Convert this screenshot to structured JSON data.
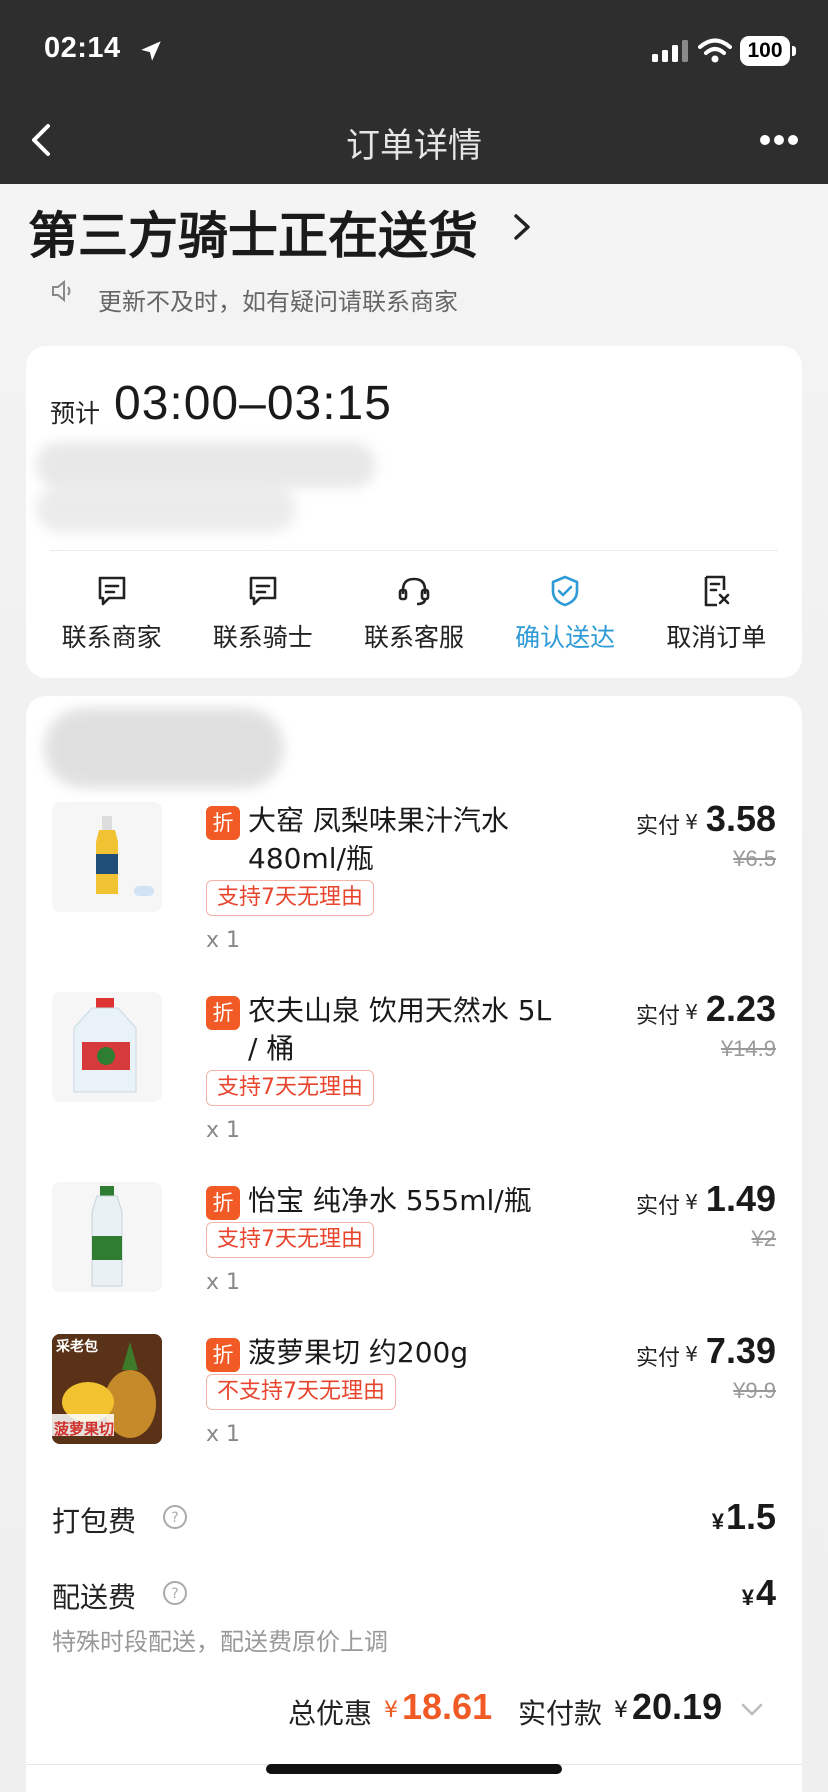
{
  "status_bar": {
    "time": "02:14",
    "battery": "100"
  },
  "nav": {
    "title": "订单详情"
  },
  "delivery": {
    "headline": "第三方骑士正在送货",
    "notice": "更新不及时，如有疑问请联系商家"
  },
  "eta": {
    "label": "预计",
    "time": "03:00–03:15"
  },
  "actions": [
    {
      "label": "联系商家",
      "icon": "chat-icon"
    },
    {
      "label": "联系骑士",
      "icon": "chat-icon"
    },
    {
      "label": "联系客服",
      "icon": "headset-icon"
    },
    {
      "label": "确认送达",
      "icon": "check-circle-icon",
      "active": true
    },
    {
      "label": "取消订单",
      "icon": "cancel-doc-icon"
    }
  ],
  "items": [
    {
      "badge": "折",
      "name": "大窑 凤梨味果汁汽水 480ml/瓶",
      "tag": "支持7天无理由",
      "qty": "x 1",
      "pay_label": "实付",
      "currency": "¥",
      "price": "3.58",
      "original": "¥6.5"
    },
    {
      "badge": "折",
      "name": "农夫山泉 饮用天然水 5L / 桶",
      "tag": "支持7天无理由",
      "qty": "x 1",
      "pay_label": "实付",
      "currency": "¥",
      "price": "2.23",
      "original": "¥14.9"
    },
    {
      "badge": "折",
      "name": "怡宝 纯净水 555ml/瓶",
      "tag": "支持7天无理由",
      "qty": "x 1",
      "pay_label": "实付",
      "currency": "¥",
      "price": "1.49",
      "original": "¥2"
    },
    {
      "badge": "折",
      "name": "菠萝果切 约200g",
      "tag": "不支持7天无理由",
      "qty": "x 1",
      "pay_label": "实付",
      "currency": "¥",
      "price": "7.39",
      "original": "¥9.9",
      "thumb_text_top": "采老包",
      "thumb_text_bottom": "菠萝果切"
    }
  ],
  "fees": {
    "packing": {
      "label": "打包费",
      "currency": "¥",
      "value": "1.5"
    },
    "delivery": {
      "label": "配送费",
      "currency": "¥",
      "value": "4",
      "note": "特殊时段配送，配送费原价上调"
    }
  },
  "totals": {
    "discount_label": "总优惠",
    "discount_currency": "¥",
    "discount_value": "18.61",
    "paid_label": "实付款",
    "paid_currency": "¥",
    "paid_value": "20.19"
  },
  "colors": {
    "accent_blue": "#2f9bd6",
    "accent_orange": "#f15a24",
    "tag_red": "#e8452e"
  }
}
